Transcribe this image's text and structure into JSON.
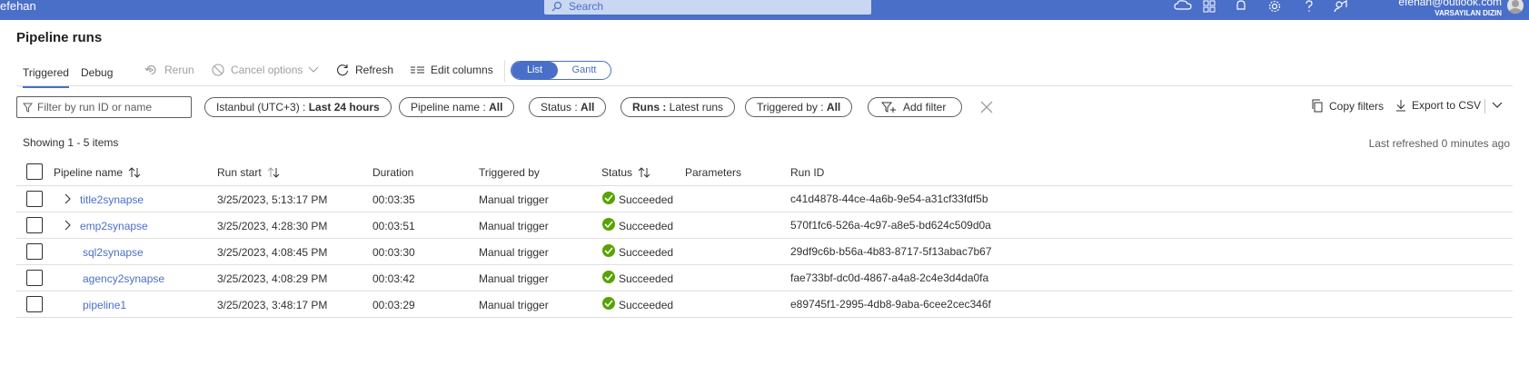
{
  "topbar": {
    "brand": "efehan",
    "search_placeholder": "Search",
    "user_email": "efehan@outlook.com",
    "directory": "VARSAYILAN DIZIN"
  },
  "page": {
    "title": "Pipeline runs"
  },
  "tabs": [
    {
      "label": "Triggered",
      "active": true
    },
    {
      "label": "Debug",
      "active": false
    }
  ],
  "commands": {
    "rerun": "Rerun",
    "cancel_options": "Cancel options",
    "refresh": "Refresh",
    "edit_columns": "Edit columns"
  },
  "view_toggle": {
    "list": "List",
    "gantt": "Gantt",
    "selected": "List"
  },
  "filters": {
    "search_placeholder": "Filter by run ID or name",
    "time": {
      "label": "Istanbul (UTC+3) : ",
      "value": "Last 24 hours"
    },
    "pipeline_name": {
      "label": "Pipeline name : ",
      "value": "All"
    },
    "status": {
      "label": "Status : ",
      "value": "All"
    },
    "runs": {
      "label": "Runs : ",
      "value": "Latest runs"
    },
    "triggered_by": {
      "label": "Triggered by : ",
      "value": "All"
    },
    "add_filter": "Add filter",
    "copy_filters": "Copy filters",
    "export_csv": "Export to CSV"
  },
  "summary": {
    "showing": "Showing 1 - 5 items",
    "last_refreshed": "Last refreshed 0 minutes ago"
  },
  "table": {
    "columns": [
      "Pipeline name",
      "Run start",
      "Duration",
      "Triggered by",
      "Status",
      "Parameters",
      "Run ID"
    ],
    "rows": [
      {
        "name": "title2synapse",
        "expandable": true,
        "run_start": "3/25/2023, 5:13:17 PM",
        "duration": "00:03:35",
        "triggered_by": "Manual trigger",
        "status": "Succeeded",
        "parameters": "",
        "run_id": "c41d4878-44ce-4a6b-9e54-a31cf33fdf5b"
      },
      {
        "name": "emp2synapse",
        "expandable": true,
        "run_start": "3/25/2023, 4:28:30 PM",
        "duration": "00:03:51",
        "triggered_by": "Manual trigger",
        "status": "Succeeded",
        "parameters": "",
        "run_id": "570f1fc6-526a-4c97-a8e5-bd624c509d0a"
      },
      {
        "name": "sql2synapse",
        "expandable": false,
        "run_start": "3/25/2023, 4:08:45 PM",
        "duration": "00:03:30",
        "triggered_by": "Manual trigger",
        "status": "Succeeded",
        "parameters": "",
        "run_id": "29df9c6b-b56a-4b83-8717-5f13abac7b67"
      },
      {
        "name": "agency2synapse",
        "expandable": false,
        "run_start": "3/25/2023, 4:08:29 PM",
        "duration": "00:03:42",
        "triggered_by": "Manual trigger",
        "status": "Succeeded",
        "parameters": "",
        "run_id": "fae733bf-dc0d-4867-a4a8-2c4e3d4da0fa"
      },
      {
        "name": "pipeline1",
        "expandable": false,
        "run_start": "3/25/2023, 3:48:17 PM",
        "duration": "00:03:29",
        "triggered_by": "Manual trigger",
        "status": "Succeeded",
        "parameters": "",
        "run_id": "e89745f1-2995-4db8-9aba-6cee2cec346f"
      }
    ]
  },
  "colors": {
    "accent": "#4a6fc8",
    "success": "#57a300"
  }
}
